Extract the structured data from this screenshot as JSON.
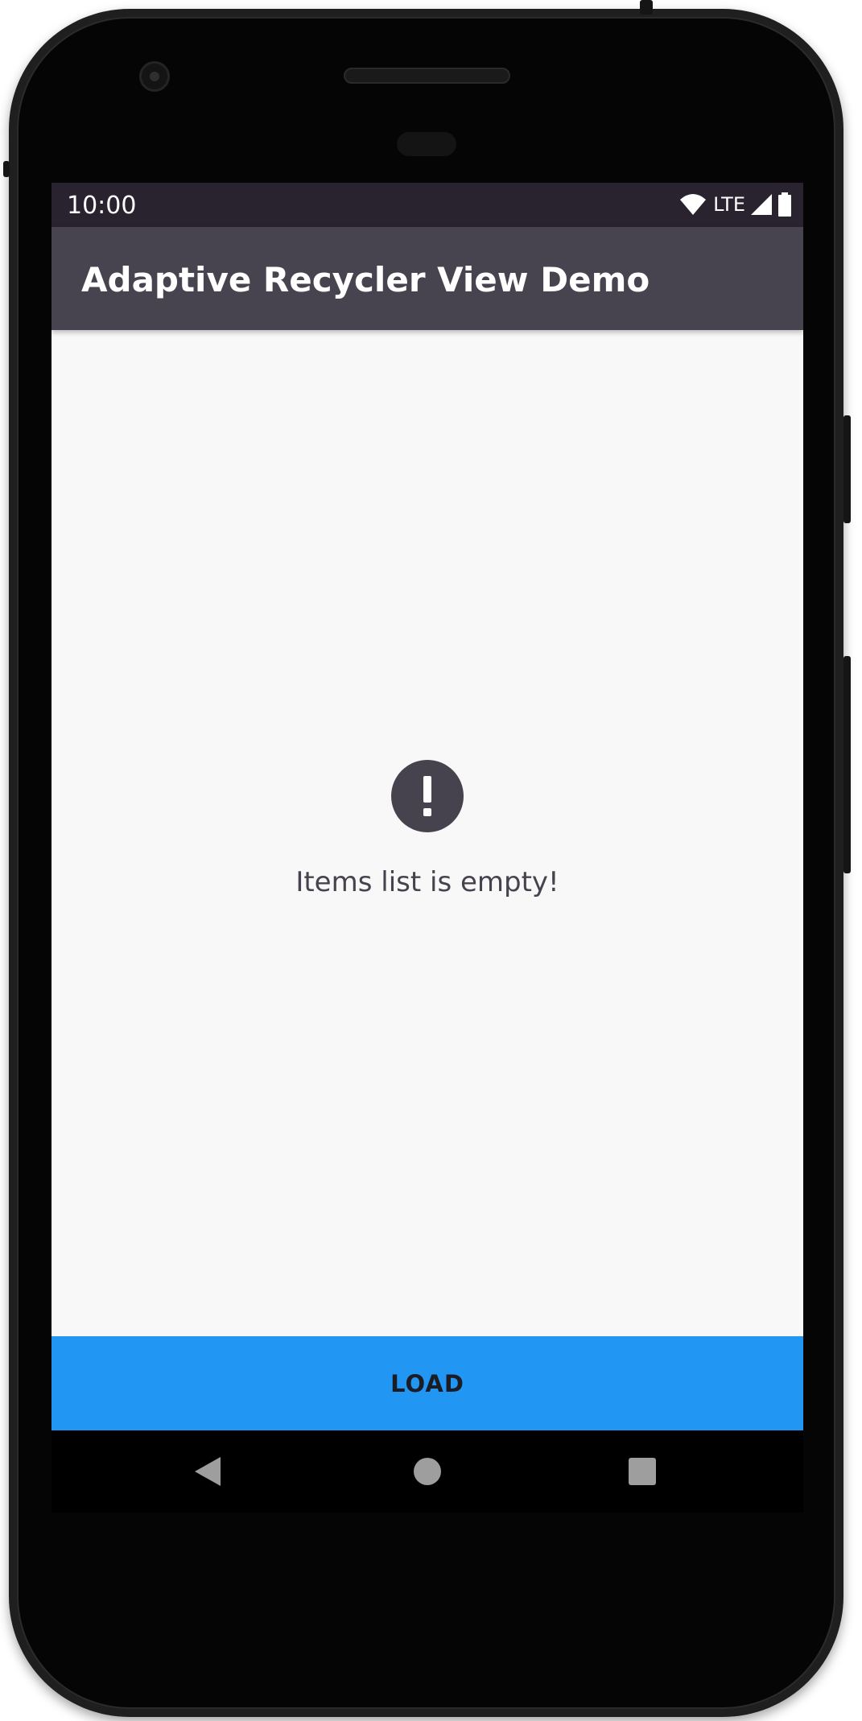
{
  "status_bar": {
    "time": "10:00",
    "network": "LTE"
  },
  "app_bar": {
    "title": "Adaptive Recycler View Demo"
  },
  "empty_state": {
    "icon": "exclamation-circle-icon",
    "message": "Items list is empty!"
  },
  "actions": {
    "load_label": "LOAD"
  },
  "nav_bar": {
    "back_icon": "back-triangle-icon",
    "home_icon": "home-circle-icon",
    "recents_icon": "recents-square-icon"
  },
  "colors": {
    "status_bar": "#28232e",
    "app_bar": "#48444f",
    "background": "#f8f8f8",
    "accent": "#2196f3",
    "empty_icon": "#47434e"
  }
}
